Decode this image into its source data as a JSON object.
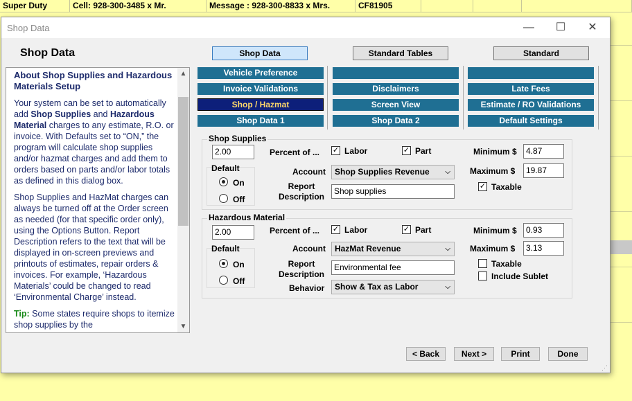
{
  "background": {
    "row1": [
      "Super Duty",
      "Cell: 928-300-3485 x Mr.",
      "Message : 928-300-8833 x Mrs.",
      "CF81905"
    ]
  },
  "dialog": {
    "title": "Shop Data",
    "heading": "Shop Data",
    "window_controls": {
      "minimize": "—",
      "maximize": "☐",
      "close": "✕"
    }
  },
  "help": {
    "title": "About Shop Supplies and Hazardous Materials Setup",
    "p1_a": "Your system can be set to automatically add ",
    "p1_b": "Shop Supplies",
    "p1_c": " and ",
    "p1_d": "Hazardous Material",
    "p1_e": " charges to any estimate, R.O. or invoice. With Defaults set to “ON,” the program will calculate shop supplies and/or hazmat charges and add them to orders based on parts and/or labor totals as defined in this dialog box.",
    "p2": "Shop Supplies and HazMat charges can always be turned off at the Order screen as needed (for that specific order only), using the Options Button. Report Description refers to the text that will be displayed in on-screen previews and printouts of estimates, repair orders & invoices. For example, ‘Hazardous Materials’ could be changed to read ‘Environmental Charge’ instead.",
    "tip_label": "Tip:",
    "tip_text": " Some states require shops to itemize shop supplies by the"
  },
  "top_tabs": [
    "Shop Data",
    "Standard Tables",
    "Standard"
  ],
  "sub_tabs": [
    [
      "Vehicle Preference",
      "",
      ""
    ],
    [
      "Invoice Validations",
      "Disclaimers",
      "Late Fees"
    ],
    [
      "Shop / Hazmat",
      "Screen View",
      "Estimate / RO Validations"
    ],
    [
      "Shop Data 1",
      "Shop Data 2",
      "Default Settings"
    ]
  ],
  "shop_supplies": {
    "group_label": "Shop Supplies",
    "percent_value": "2.00",
    "percent_of_label": "Percent of ...",
    "labor_label": "Labor",
    "labor_checked": true,
    "part_label": "Part",
    "part_checked": true,
    "minimum_label": "Minimum $",
    "minimum_value": "4.87",
    "maximum_label": "Maximum $",
    "maximum_value": "19.87",
    "taxable_label": "Taxable",
    "taxable_checked": true,
    "default_label": "Default",
    "on_label": "On",
    "off_label": "Off",
    "default_selected": "On",
    "account_label": "Account",
    "account_value": "Shop Supplies Revenue",
    "report_label": "Report",
    "description_label": "Description",
    "report_description_value": "Shop supplies"
  },
  "hazardous_material": {
    "group_label": "Hazardous Material",
    "percent_value": "2.00",
    "percent_of_label": "Percent of ...",
    "labor_label": "Labor",
    "labor_checked": true,
    "part_label": "Part",
    "part_checked": true,
    "minimum_label": "Minimum $",
    "minimum_value": "0.93",
    "maximum_label": "Maximum $",
    "maximum_value": "3.13",
    "taxable_label": "Taxable",
    "taxable_checked": false,
    "include_sublet_label": "Include Sublet",
    "include_sublet_checked": false,
    "default_label": "Default",
    "on_label": "On",
    "off_label": "Off",
    "default_selected": "On",
    "account_label": "Account",
    "account_value": "HazMat Revenue",
    "report_label": "Report",
    "description_label": "Description",
    "report_description_value": "Environmental fee",
    "behavior_label": "Behavior",
    "behavior_value": "Show & Tax as Labor"
  },
  "footer": {
    "back": "< Back",
    "next": "Next >",
    "print": "Print",
    "done": "Done"
  }
}
